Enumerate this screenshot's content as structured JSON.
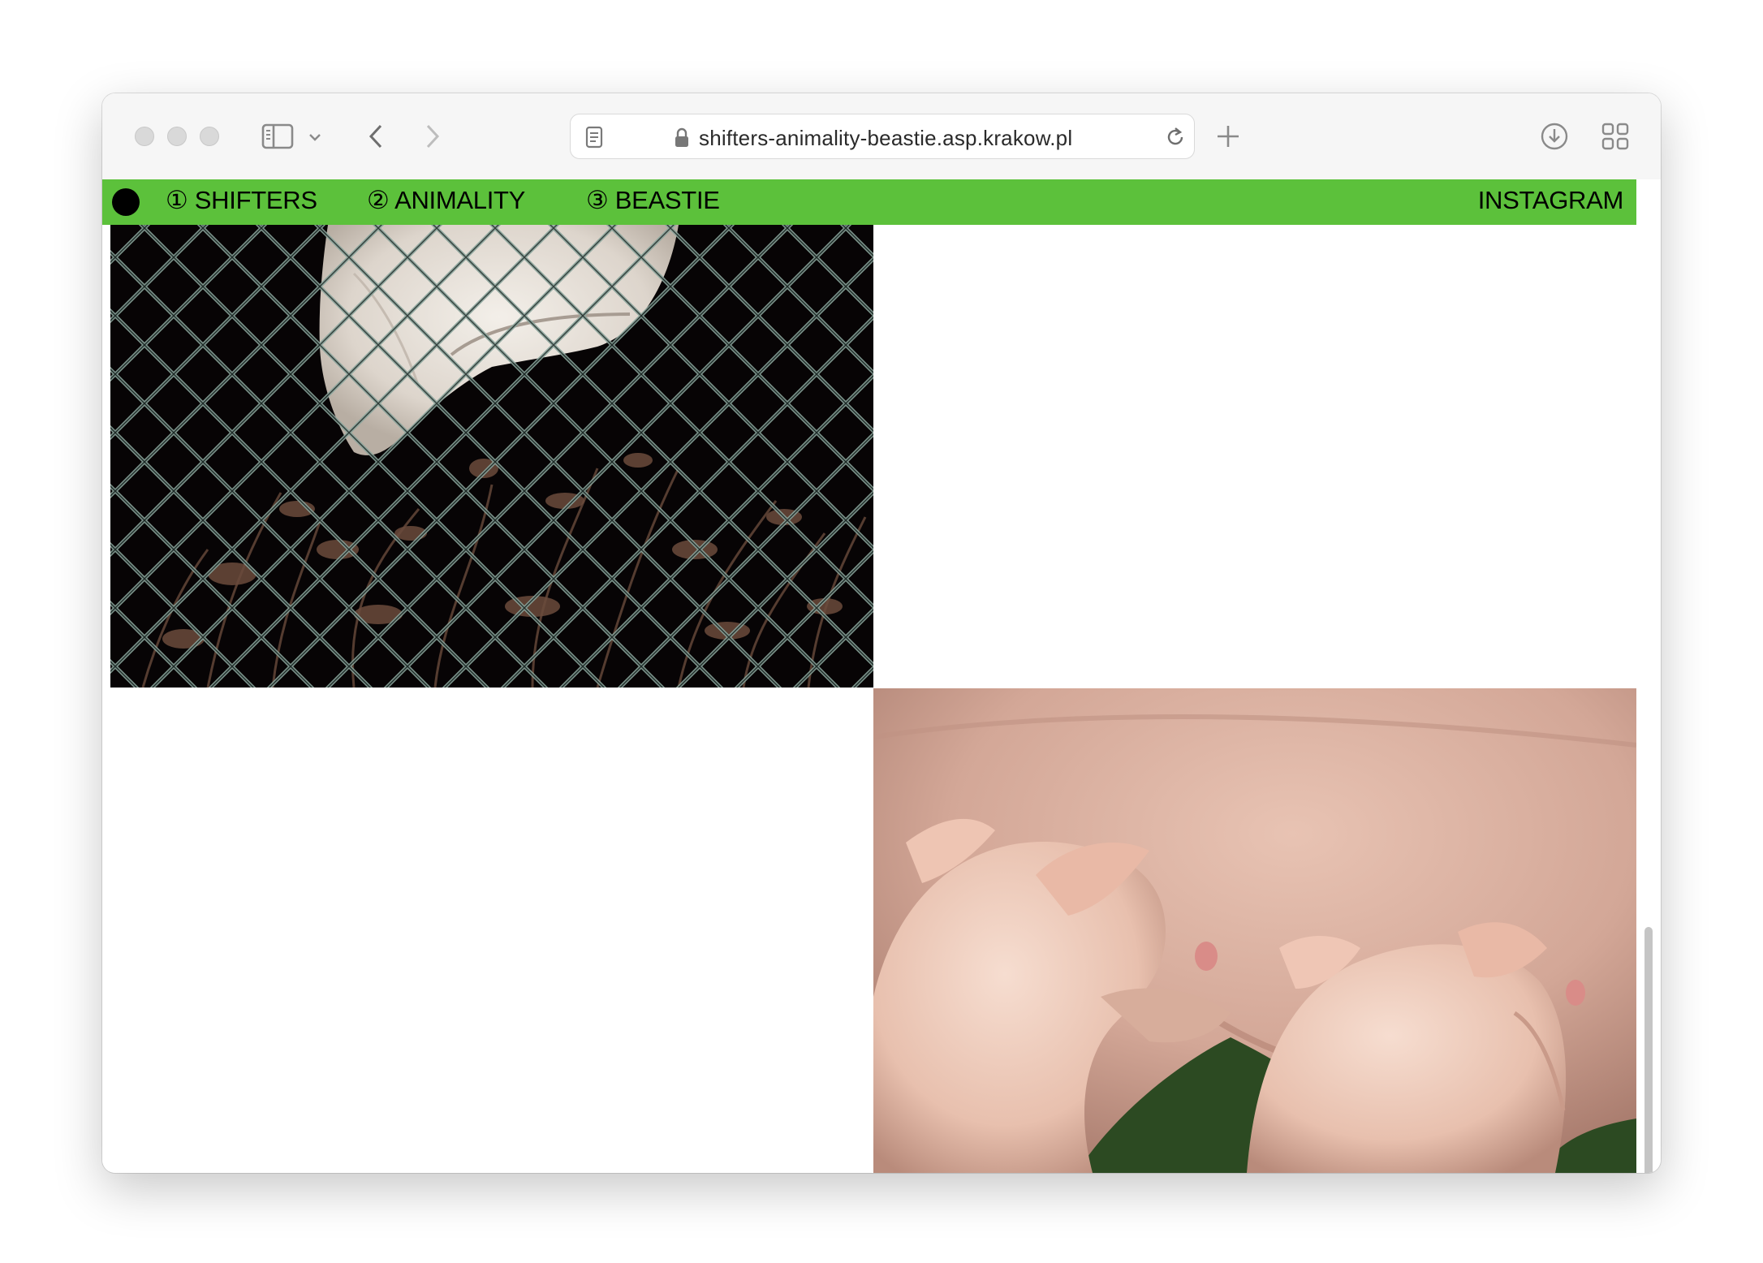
{
  "browser": {
    "url": "shifters-animality-beastie.asp.krakow.pl",
    "icons": [
      "sidebar-icon",
      "chevron-down-icon",
      "back-icon",
      "forward-icon",
      "reader-icon",
      "lock-icon",
      "reload-icon",
      "new-tab-icon",
      "download-icon",
      "tab-overview-icon"
    ]
  },
  "site": {
    "nav_color": "#5cc13b",
    "nav": {
      "item1": "① SHIFTERS",
      "item2": "② ANIMALITY",
      "item3": "③ BEASTIE",
      "instagram": "INSTAGRAM"
    }
  },
  "gallery": {
    "images": [
      "chain-link fence with fungus at night",
      "piglets nursing from sow"
    ]
  }
}
